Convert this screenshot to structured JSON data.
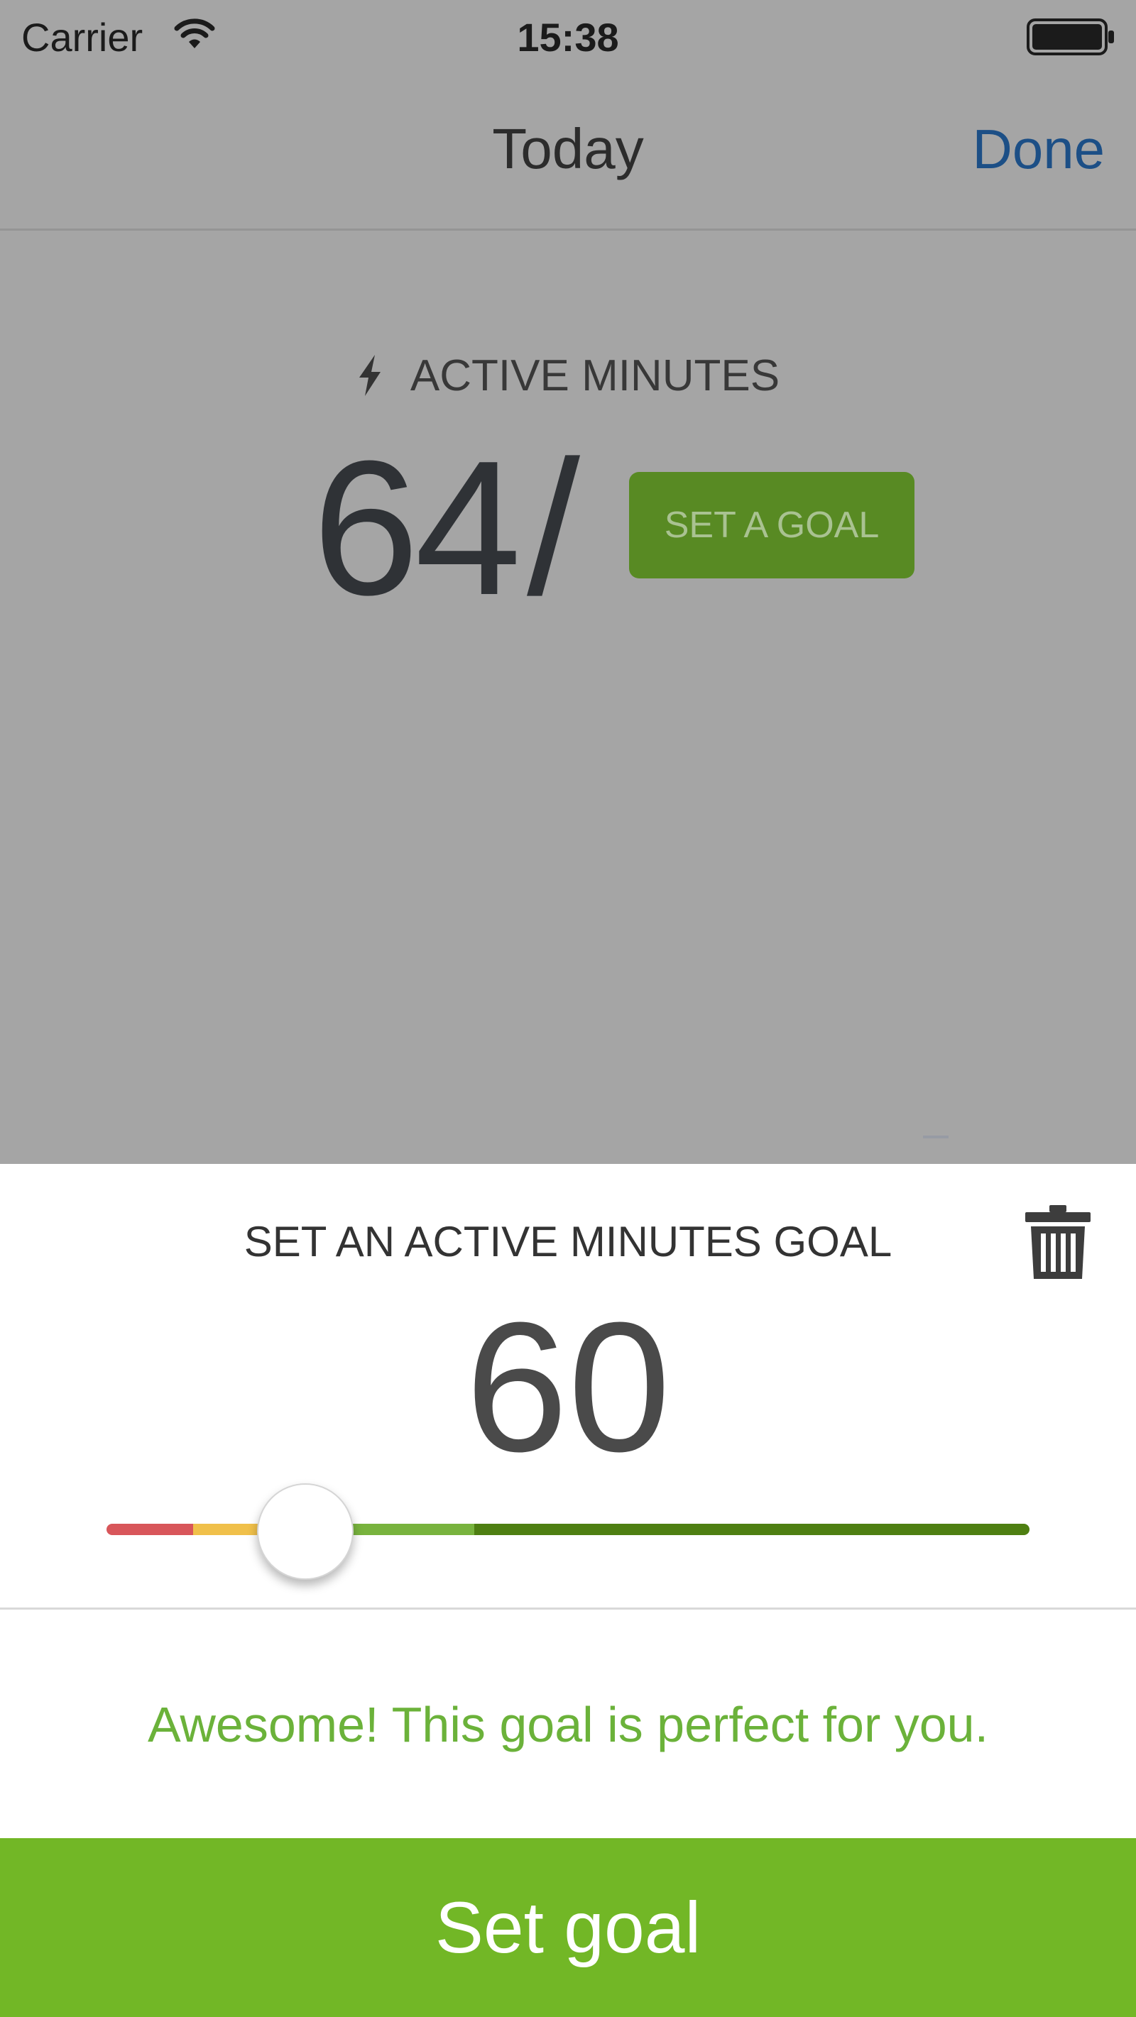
{
  "status_bar": {
    "carrier": "Carrier",
    "time": "15:38",
    "wifi_icon": "wifi-icon",
    "battery_icon": "battery-icon"
  },
  "nav": {
    "title": "Today",
    "done_label": "Done"
  },
  "metric": {
    "icon": "bolt-icon",
    "label": "ACTIVE MINUTES",
    "value": "64",
    "separator": "/",
    "set_goal_label": "SET A GOAL"
  },
  "goal_sheet": {
    "title": "SET AN ACTIVE MINUTES GOAL",
    "delete_icon": "trash-icon",
    "value": "60",
    "slider_position_fraction": 0.215,
    "slider_zone_colors": [
      "#d8565a",
      "#f0c04a",
      "#78b33e",
      "#4e7f12"
    ],
    "feedback": "Awesome! This goal is perfect for you.",
    "submit_label": "Set goal"
  },
  "colors": {
    "accent_green": "#72b726",
    "chip_green": "#588a23",
    "feedback_green": "#6bb23a",
    "done_blue": "#1c4f86",
    "overlay_gray": "#a5a5a5"
  }
}
